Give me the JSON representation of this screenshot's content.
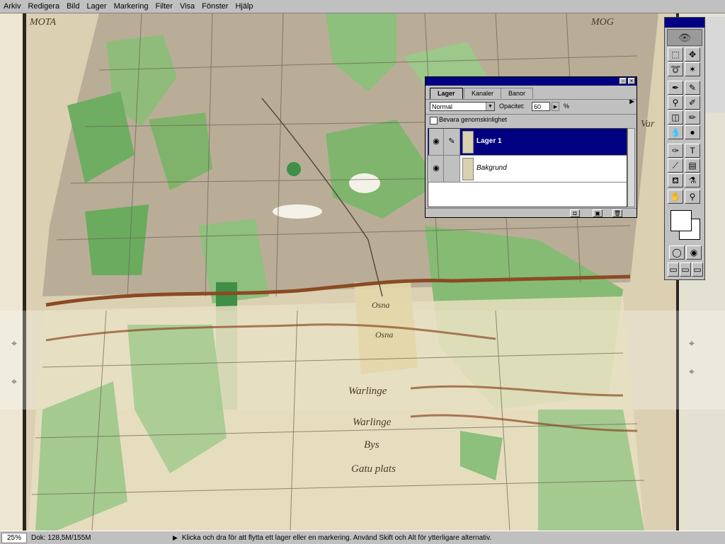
{
  "menu": [
    "Arkiv",
    "Redigera",
    "Bild",
    "Lager",
    "Markering",
    "Filter",
    "Visa",
    "Fönster",
    "Hjälp"
  ],
  "layers_palette": {
    "tabs": [
      "Lager",
      "Kanaler",
      "Banor"
    ],
    "blend_mode": "Normal",
    "opacity_label": "Opacitet:",
    "opacity_value": "60",
    "opacity_unit": "%",
    "preserve_label": "Bevara genomskinlighet",
    "layers": [
      {
        "name": "Lager 1",
        "selected": true
      },
      {
        "name": "Bakgrund",
        "selected": false
      }
    ]
  },
  "map_text": {
    "top_left": "MOTA",
    "top_right": "MOG",
    "osna_1": "Osna",
    "osna_2": "Osna",
    "warlinge_1": "Warlinge",
    "warlinge_2": "Warlinge",
    "bys": "Bys",
    "gatu": "Gatu plats",
    "var": "Var"
  },
  "status": {
    "zoom": "25%",
    "doc": "Dok: 128,5M/155M",
    "message": "Klicka och dra för att flytta ett lager eller en markering. Använd Skift och Alt för ytterligare alternativ."
  },
  "colors": {
    "paper": "#e6dcbf",
    "green": "#8fc07f",
    "dark_green": "#4f9a52",
    "road": "#8b4a23",
    "selection": "#000080"
  }
}
